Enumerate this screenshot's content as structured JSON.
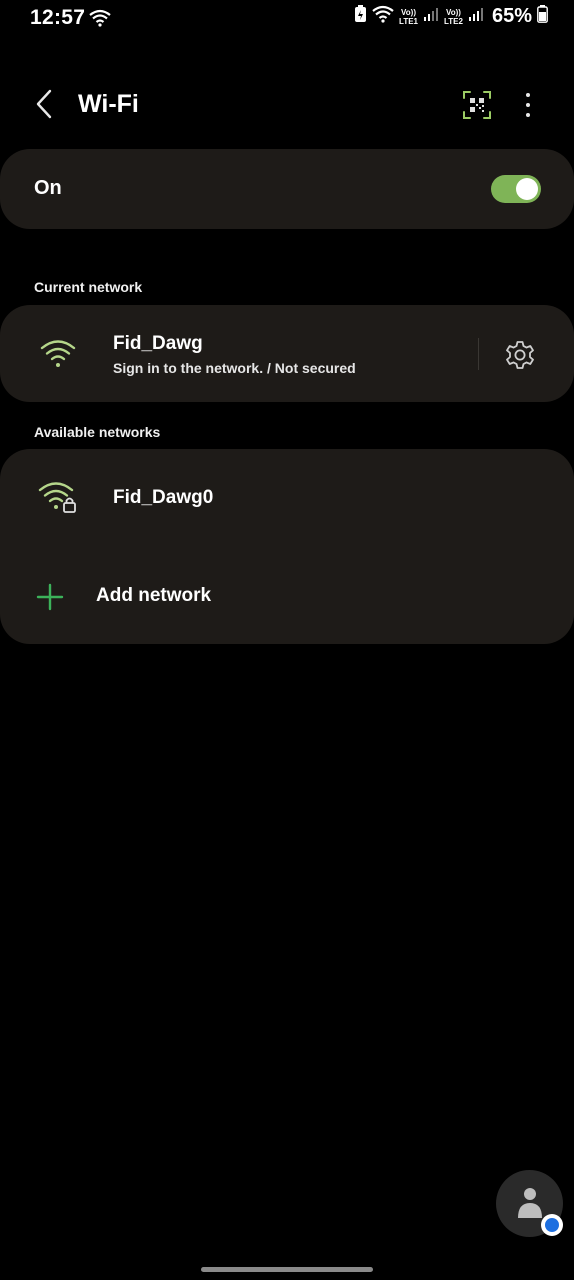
{
  "status_bar": {
    "time": "12:57",
    "sim1_top": "Vo))",
    "sim1_bottom": "LTE1",
    "sim2_top": "Vo))",
    "sim2_bottom": "LTE2",
    "battery_percent": "65%"
  },
  "header": {
    "title": "Wi-Fi",
    "back_icon": "chevron-left-icon",
    "qr_icon": "qr-scan-icon",
    "more_icon": "more-vertical-icon"
  },
  "wifi_toggle": {
    "label": "On",
    "state": true
  },
  "current_network": {
    "section_title": "Current network",
    "name": "Fid_Dawg",
    "status": "Sign in to the network. / Not secured",
    "settings_icon": "gear-icon"
  },
  "available_networks": {
    "section_title": "Available networks",
    "items": [
      {
        "name": "Fid_Dawg0",
        "icon": "wifi-locked-icon"
      }
    ],
    "add_network_label": "Add network"
  },
  "colors": {
    "accent_green": "#8bc34a",
    "card_bg": "#1e1b18",
    "wifi_icon": "#b5d68a",
    "switch_track": "#7fb457"
  }
}
